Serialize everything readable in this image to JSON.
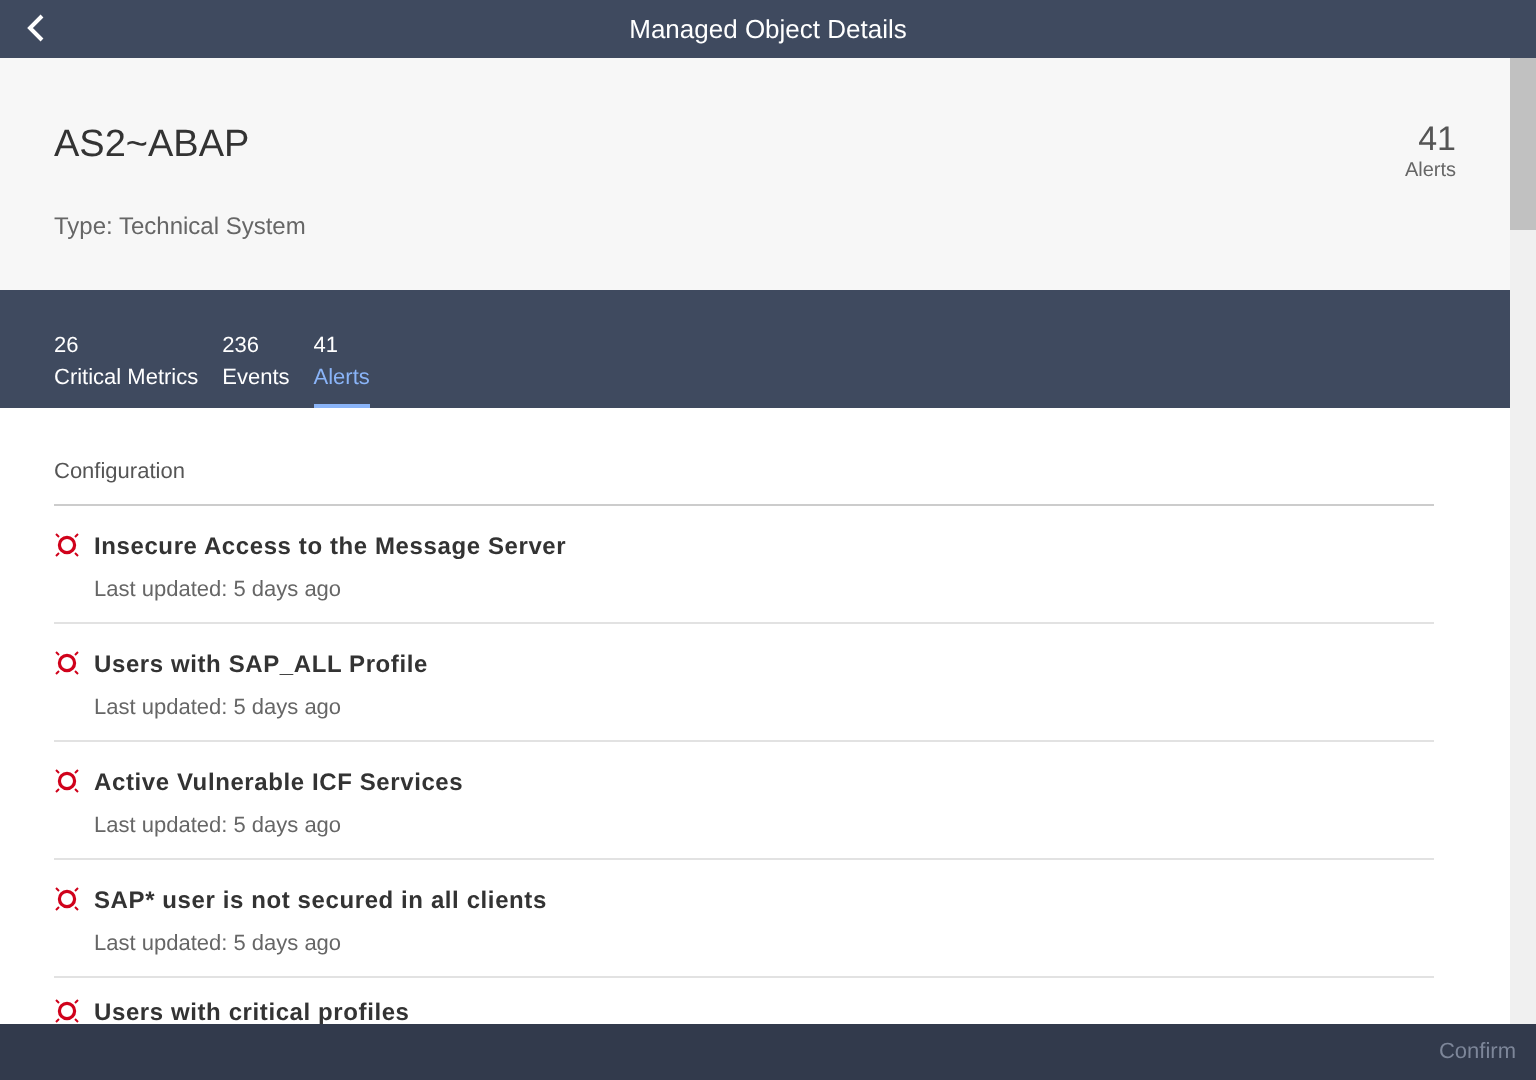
{
  "window": {
    "title": "Managed Object Details"
  },
  "object": {
    "name": "AS2~ABAP",
    "type": "Type: Technical System",
    "count": "41",
    "count_label": "Alerts"
  },
  "tabs": [
    {
      "count": "26",
      "label": "Critical Metrics",
      "selected": false
    },
    {
      "count": "236",
      "label": "Events",
      "selected": false
    },
    {
      "count": "41",
      "label": "Alerts",
      "selected": true
    }
  ],
  "group": "Configuration",
  "alerts": [
    {
      "title": "Insecure Access to the Message Server",
      "updated": "Last updated: 5 days ago"
    },
    {
      "title": "Users with SAP_ALL Profile",
      "updated": "Last updated: 5 days ago"
    },
    {
      "title": "Active Vulnerable ICF Services",
      "updated": "Last updated: 5 days ago"
    },
    {
      "title": "SAP* user is not secured in all clients",
      "updated": "Last updated: 5 days ago"
    },
    {
      "title": "Users with critical profiles"
    }
  ],
  "footer": {
    "button": "Confirm"
  }
}
